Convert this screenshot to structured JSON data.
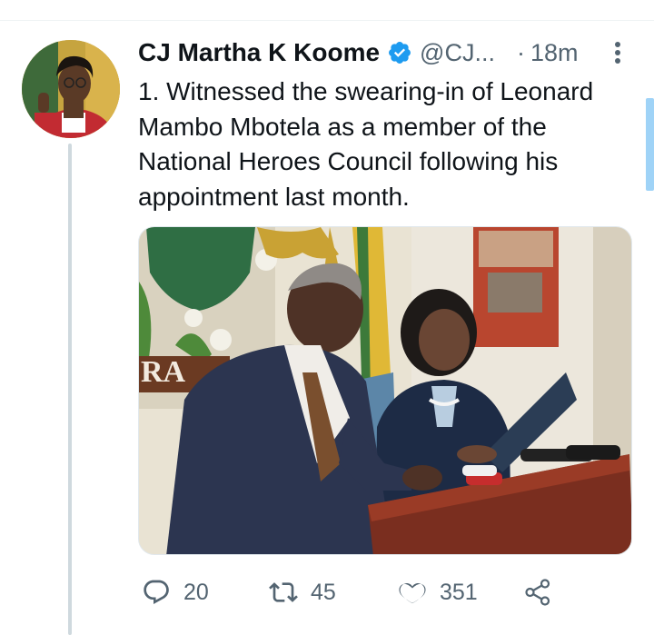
{
  "tweet": {
    "author_name": "CJ Martha K Koome",
    "handle": "@CJ...",
    "separator": "·",
    "time": "18m",
    "text": "1. Witnessed the swearing-in of Leonard Mambo Mbotela as a member of the National Heroes Council following his appointment last month.",
    "verified": true
  },
  "media": {
    "sign_text": "RA"
  },
  "actions": {
    "replies": "20",
    "retweets": "45",
    "likes": "351"
  },
  "colors": {
    "verified_blue": "#1d9bf0",
    "secondary_text": "#536471",
    "thread_line": "#cfd9de"
  },
  "icons": [
    "verified-badge-icon",
    "more-options-icon",
    "reply-icon",
    "retweet-icon",
    "like-icon",
    "share-icon"
  ]
}
